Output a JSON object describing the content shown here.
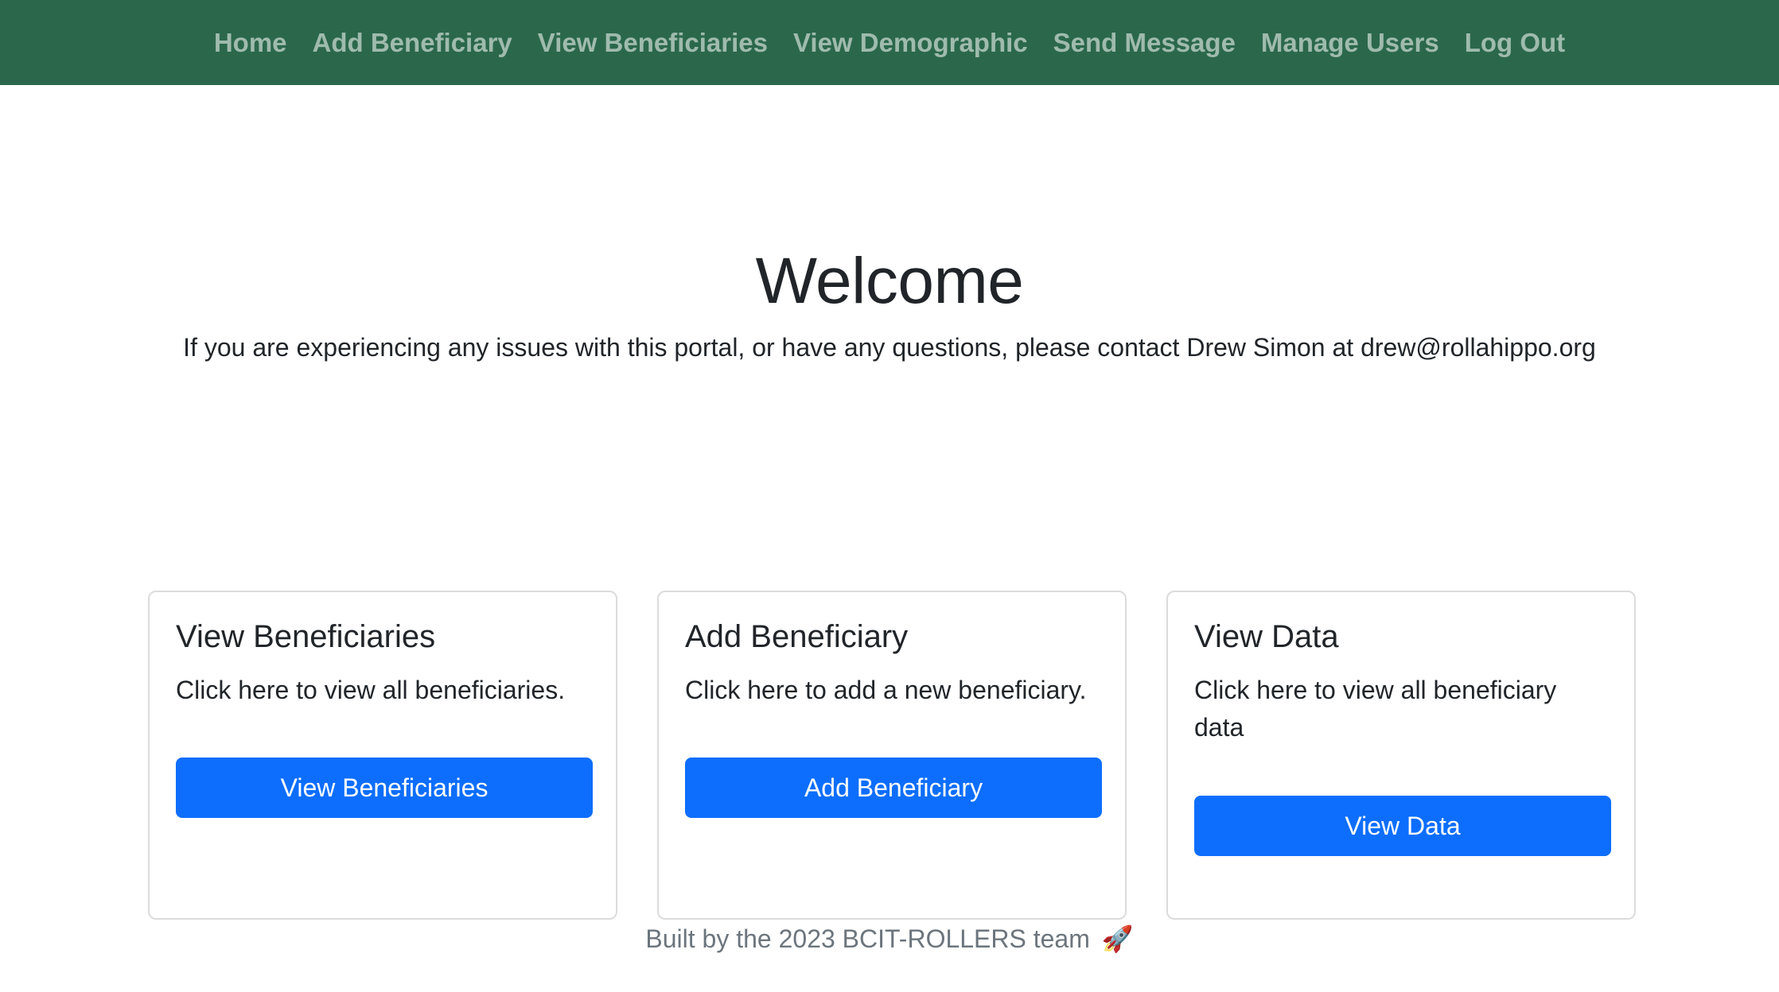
{
  "nav": {
    "items": [
      {
        "label": "Home"
      },
      {
        "label": "Add Beneficiary"
      },
      {
        "label": "View Beneficiaries"
      },
      {
        "label": "View Demographic"
      },
      {
        "label": "Send Message"
      },
      {
        "label": "Manage Users"
      },
      {
        "label": "Log Out"
      }
    ]
  },
  "hero": {
    "title": "Welcome",
    "text": "If you are experiencing any issues with this portal, or have any questions, please contact Drew Simon at drew@rollahippo.org"
  },
  "cards": [
    {
      "title": "View Beneficiaries",
      "text": "Click here to view all beneficiaries.",
      "button": "View Beneficiaries"
    },
    {
      "title": "Add Beneficiary",
      "text": "Click here to add a new beneficiary.",
      "button": "Add Beneficiary"
    },
    {
      "title": "View Data",
      "text": "Click here to view all beneficiary data",
      "button": "View Data"
    }
  ],
  "footer": {
    "text": "Built by the 2023 BCIT-ROLLERS team",
    "icon": "rocket-icon"
  },
  "colors": {
    "navbar": "#2b684b",
    "primary_button": "#0d6efd",
    "nav_link": "rgba(255,255,255,0.55)",
    "footer_text": "#6c757d"
  }
}
